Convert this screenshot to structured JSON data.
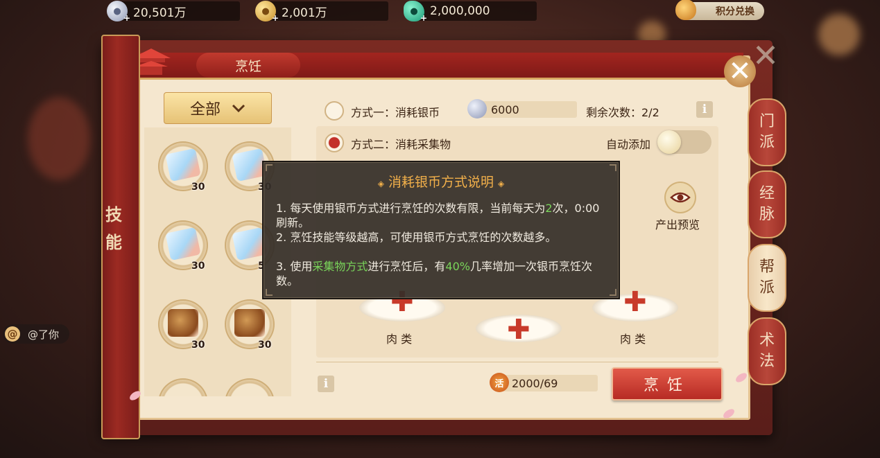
{
  "currencies": [
    {
      "icon": "silver-coin-icon",
      "value": "20,501万"
    },
    {
      "icon": "gold-coin-icon",
      "value": "2,001万"
    },
    {
      "icon": "jade-icon",
      "value": "2,000,000"
    }
  ],
  "exchange_button": "积分兑换",
  "window_title": "烹饪",
  "side_label": [
    "技",
    "能"
  ],
  "filter": {
    "label": "全部"
  },
  "items": [
    {
      "kind": "ice",
      "qty": "30"
    },
    {
      "kind": "ice",
      "qty": "30"
    },
    {
      "kind": "ice",
      "qty": "30"
    },
    {
      "kind": "ice",
      "qty": "5"
    },
    {
      "kind": "meat",
      "qty": "30"
    },
    {
      "kind": "meat",
      "qty": "30"
    }
  ],
  "method1": {
    "label": "方式一：消耗银币",
    "cost": "6000",
    "remaining_label": "剩余次数：2/2"
  },
  "method2": {
    "label": "方式二：消耗采集物",
    "auto_add": "自动添加"
  },
  "preview_label": "产出预览",
  "ingredient_slots": [
    {
      "label": "肉 类"
    },
    {
      "label": ""
    },
    {
      "label": "肉 类"
    }
  ],
  "vigor": {
    "icon_text": "活",
    "value": "2000/69"
  },
  "cook_button": "烹饪",
  "tabs": [
    {
      "label": "门派",
      "chars": [
        "门",
        "派"
      ]
    },
    {
      "label": "经脉",
      "chars": [
        "经",
        "脉"
      ]
    },
    {
      "label": "帮派",
      "chars": [
        "帮",
        "派"
      ]
    },
    {
      "label": "术法",
      "chars": [
        "术",
        "法"
      ]
    }
  ],
  "tooltip": {
    "title": "消耗银币方式说明",
    "line1_a": "1. 每天使用银币方式进行烹饪的次数有限，当前每天为",
    "line1_b": "2",
    "line1_c": "次，0:00刷新。",
    "line2": "2. 烹饪技能等级越高，可使用银币方式烹饪的次数越多。",
    "line3_a": "3. 使用",
    "line3_b": "采集物方式",
    "line3_c": "进行烹饪后，有",
    "line3_d": "40%",
    "line3_e": "几率增加一次银币烹饪次数。"
  },
  "chat": {
    "text": "@了你",
    "icon_text": "@"
  },
  "colors": {
    "accent_red": "#b72b24",
    "highlight_green": "#79d45a",
    "tooltip_title": "#f2b04a"
  }
}
